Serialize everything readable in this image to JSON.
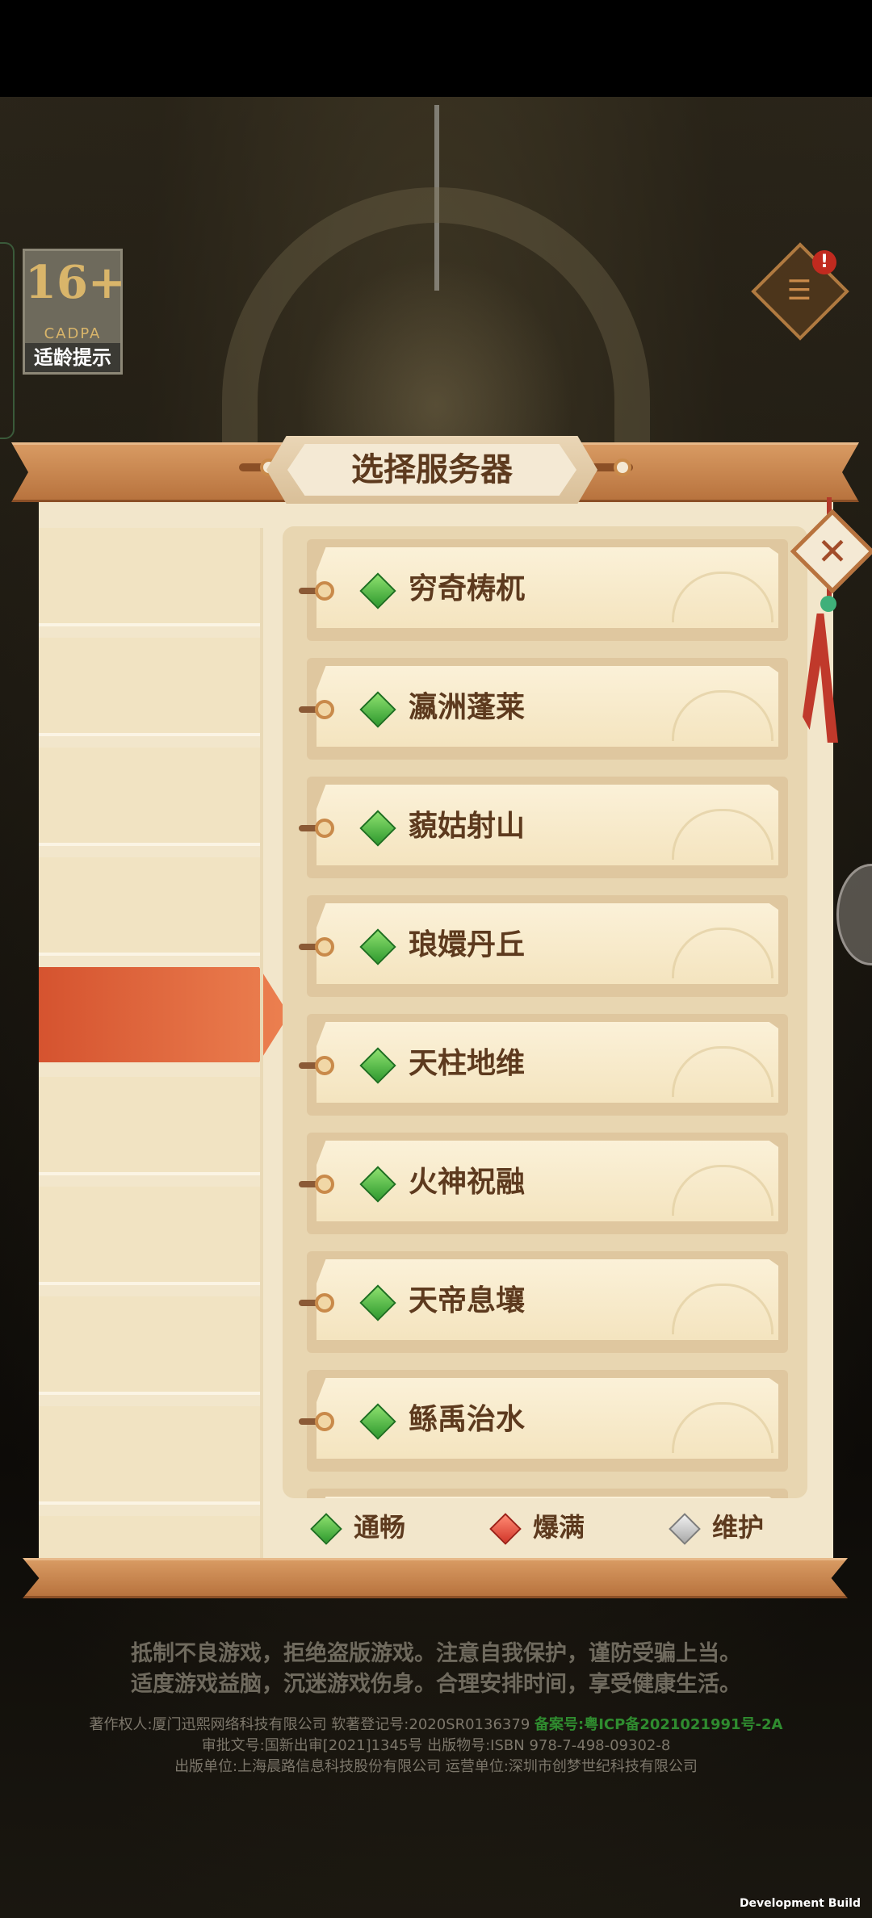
{
  "age_rating": {
    "number": "16+",
    "org": "CADPA",
    "label": "适龄提示"
  },
  "notice": {
    "badge": "!",
    "icon": "notice-board-icon"
  },
  "panel": {
    "title": "选择服务器",
    "close_icon": "close-icon",
    "servers": [
      {
        "name": "穷奇梼杌",
        "status": "green"
      },
      {
        "name": "瀛洲蓬莱",
        "status": "green"
      },
      {
        "name": "藐姑射山",
        "status": "green"
      },
      {
        "name": "琅嬛丹丘",
        "status": "green"
      },
      {
        "name": "天柱地维",
        "status": "green"
      },
      {
        "name": "火神祝融",
        "status": "green"
      },
      {
        "name": "天帝息壤",
        "status": "green"
      },
      {
        "name": "鲧禹治水",
        "status": "green"
      }
    ],
    "legend": [
      {
        "label": "通畅",
        "color": "green"
      },
      {
        "label": "爆满",
        "color": "red"
      },
      {
        "label": "维护",
        "color": "gray"
      }
    ]
  },
  "footer": {
    "health_line1": "抵制不良游戏，拒绝盗版游戏。注意自我保护，谨防受骗上当。",
    "health_line2": "适度游戏益脑，沉迷游戏伤身。合理安排时间，享受健康生活。",
    "copyright": "著作权人:厦门迅熙网络科技有限公司  软著登记号:2020SR0136379",
    "icp": "备案号:粤ICP备2021021991号-2A",
    "approval": "审批文号:国新出审[2021]1345号  出版物号:ISBN 978-7-498-09302-8",
    "publisher": "出版单位:上海晨路信息科技股份有限公司  运营单位:深圳市创梦世纪科技有限公司",
    "dev_build": "Development Build"
  }
}
